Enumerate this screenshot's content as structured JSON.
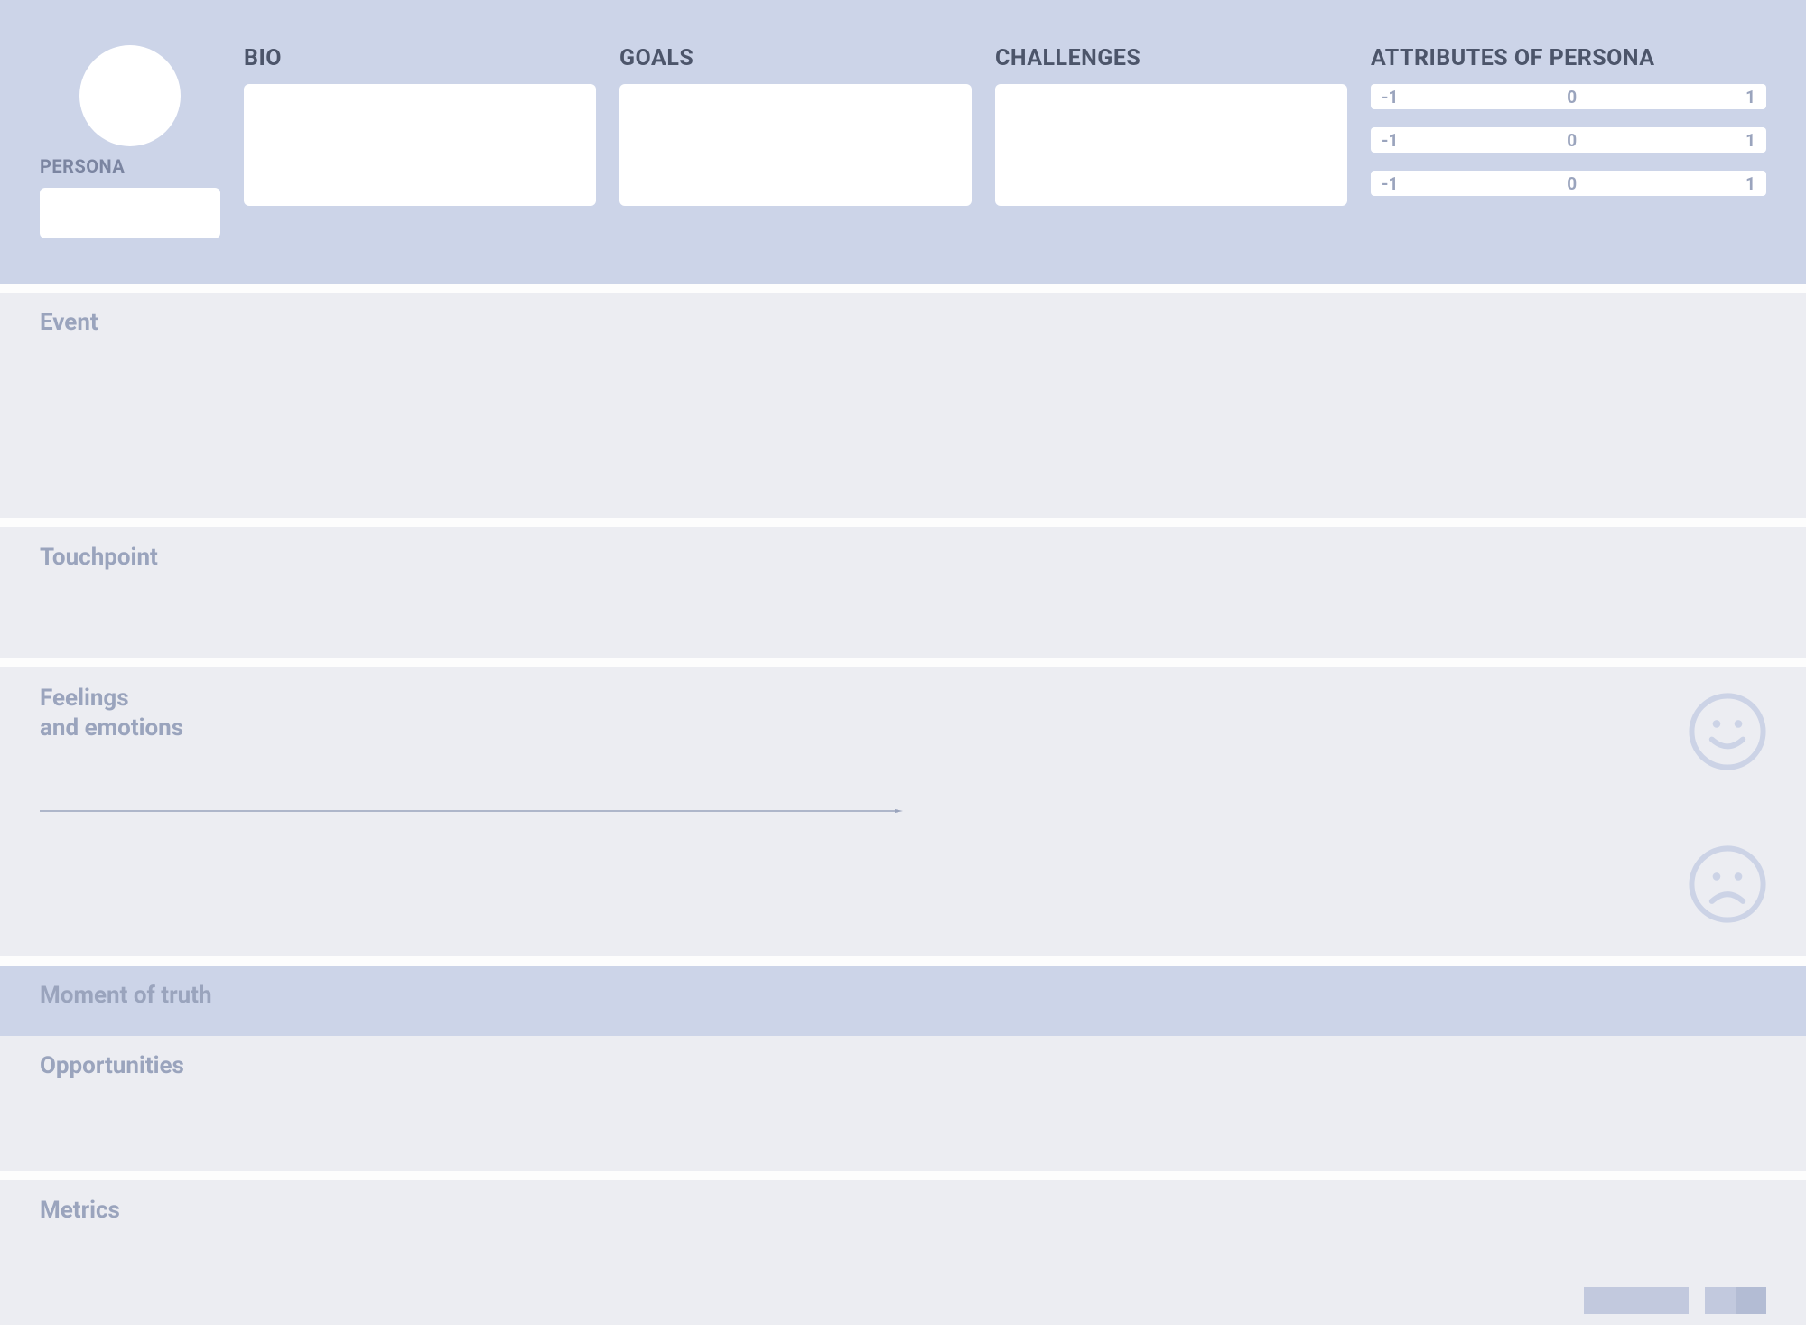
{
  "header": {
    "persona": {
      "label": "PERSONA",
      "name": ""
    },
    "bio": {
      "title": "BIO",
      "value": ""
    },
    "goals": {
      "title": "GOALS",
      "value": ""
    },
    "challenges": {
      "title": "CHALLENGES",
      "value": ""
    },
    "attributes": {
      "title": "ATTRIBUTES OF PERSONA",
      "scales": [
        {
          "min": "-1",
          "mid": "0",
          "max": "1"
        },
        {
          "min": "-1",
          "mid": "0",
          "max": "1"
        },
        {
          "min": "-1",
          "mid": "0",
          "max": "1"
        }
      ]
    }
  },
  "rows": {
    "event": "Event",
    "touchpoint": "Touchpoint",
    "feelings_line1": "Feelings",
    "feelings_line2": "and emotions",
    "moment": "Moment of truth",
    "opportunities": "Opportunities",
    "metrics": "Metrics"
  },
  "colors": {
    "header_bg": "#ccd4e8",
    "row_bg": "#ecedf2",
    "separator": "#fdfdfd",
    "label_muted": "#9aa4bd",
    "label_dark": "#4c556a"
  }
}
